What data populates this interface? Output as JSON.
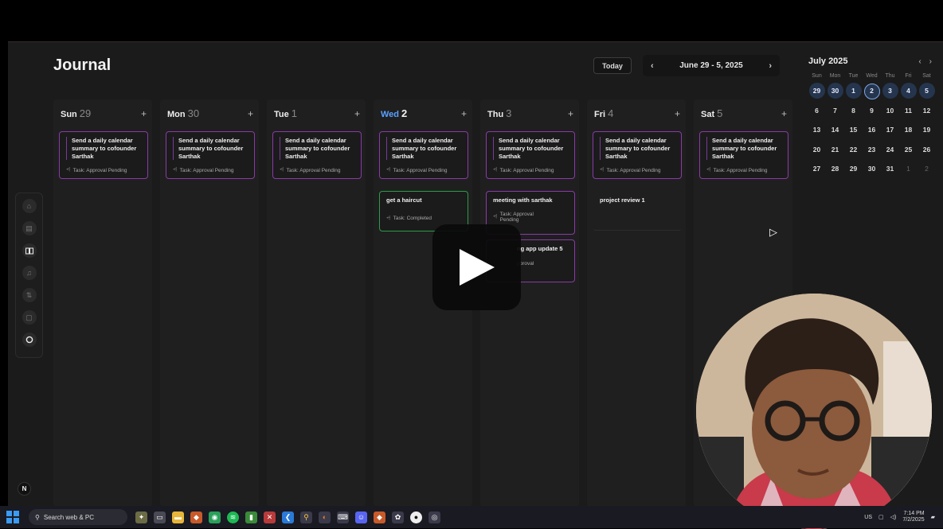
{
  "app": {
    "title": "Journal",
    "today_label": "Today",
    "prev_label": "‹",
    "next_label": "›",
    "range_label": "June 29 - 5, 2025"
  },
  "week": [
    {
      "name": "Sun",
      "num": "29",
      "current": false
    },
    {
      "name": "Mon",
      "num": "30",
      "current": false
    },
    {
      "name": "Tue",
      "num": "1",
      "current": false
    },
    {
      "name": "Wed",
      "num": "2",
      "current": true
    },
    {
      "name": "Thu",
      "num": "3",
      "current": false
    },
    {
      "name": "Fri",
      "num": "4",
      "current": false
    },
    {
      "name": "Sat",
      "num": "5",
      "current": false
    }
  ],
  "add_label": "+",
  "tasks": {
    "recurring_title": "Send a daily calendar summary to cofounder Sarthak",
    "recurring_status": "Task: Approval Pending",
    "haircut_title": "get a haircut",
    "haircut_status": "Task: Completed",
    "meeting_title": "meeting with sarthak",
    "meeting_status": "Task: Approval Pending",
    "app_update_title": "ng app update 5",
    "app_update_status": "pproval",
    "review_title": "project review 1"
  },
  "mini_calendar": {
    "month": "July 2025",
    "prev": "‹",
    "next": "›",
    "dow": [
      "Sun",
      "Mon",
      "Tue",
      "Wed",
      "Thu",
      "Fri",
      "Sat"
    ],
    "rows": [
      [
        "29",
        "30",
        "1",
        "2",
        "3",
        "4",
        "5"
      ],
      [
        "6",
        "7",
        "8",
        "9",
        "10",
        "11",
        "12"
      ],
      [
        "13",
        "14",
        "15",
        "16",
        "17",
        "18",
        "19"
      ],
      [
        "20",
        "21",
        "22",
        "23",
        "24",
        "25",
        "26"
      ],
      [
        "27",
        "28",
        "29",
        "30",
        "31",
        "1",
        "2"
      ]
    ]
  },
  "taskbar": {
    "search_placeholder": "Search web & PC",
    "lang": "US",
    "time": "7:14 PM",
    "date": "7/2/2025"
  },
  "badge_letter": "N"
}
